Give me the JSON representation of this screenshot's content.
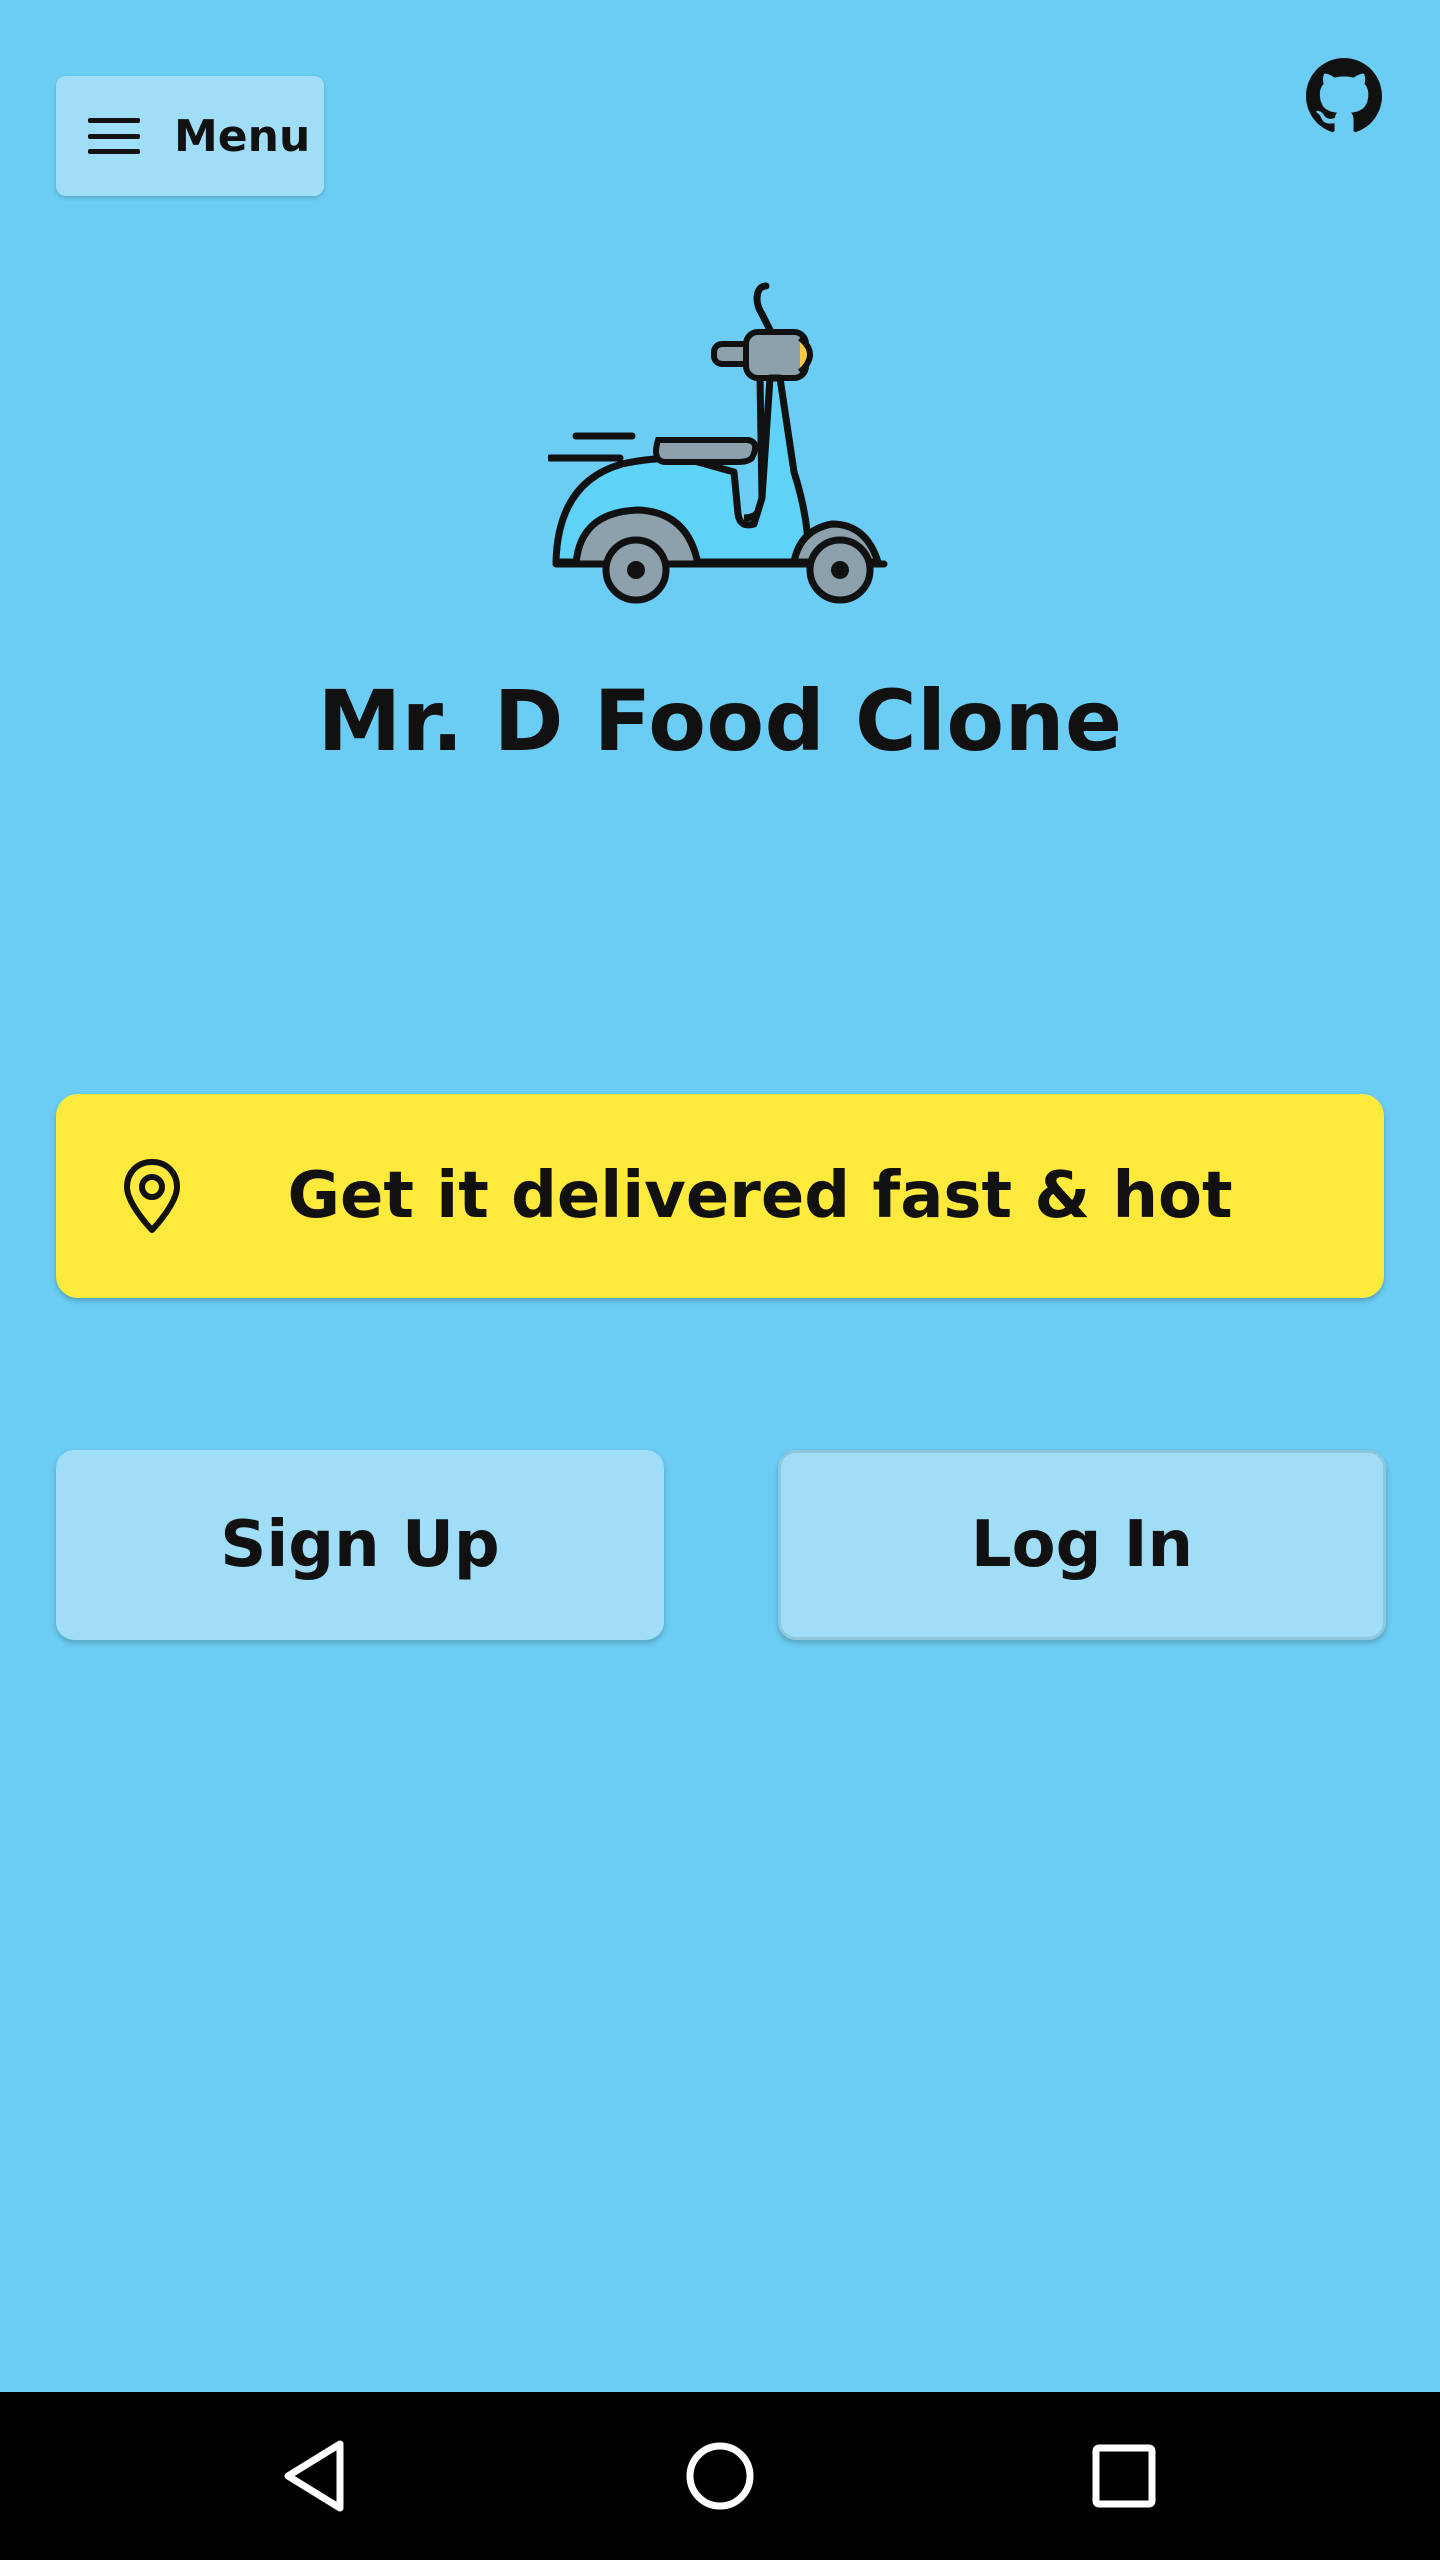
{
  "header": {
    "menu_label": "Menu",
    "menu_icon": "hamburger-icon",
    "github_icon": "github-icon"
  },
  "hero": {
    "illustration": "scooter-icon",
    "title": "Mr. D Food Clone"
  },
  "cta": {
    "icon": "location-pin-icon",
    "label": "Get it delivered fast & hot"
  },
  "auth": {
    "signup_label": "Sign Up",
    "login_label": "Log In"
  },
  "system_nav": {
    "back_icon": "back-triangle-icon",
    "home_icon": "home-circle-icon",
    "recents_icon": "recents-square-icon"
  },
  "colors": {
    "background": "#6ccdf4",
    "button_light": "#a0def8",
    "accent_yellow": "#feea3c",
    "navbar": "#000000"
  }
}
